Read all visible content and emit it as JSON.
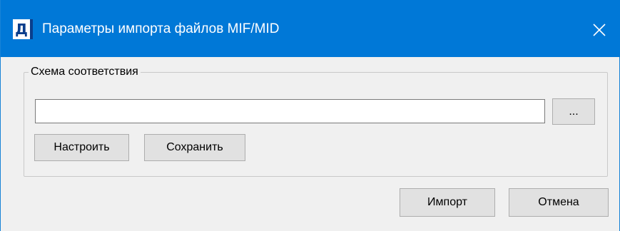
{
  "window": {
    "title": "Параметры импорта файлов MIF/MID",
    "icon_glyph": "Д",
    "icon_name": "app-icon",
    "close_icon": "close-icon",
    "titlebar_color": "#0078d7"
  },
  "group": {
    "legend": "Схема соответствия",
    "path_input": {
      "value": "",
      "placeholder": ""
    },
    "browse_label": "...",
    "configure_label": "Настроить",
    "save_label": "Сохранить"
  },
  "footer": {
    "import_label": "Импорт",
    "cancel_label": "Отмена"
  }
}
